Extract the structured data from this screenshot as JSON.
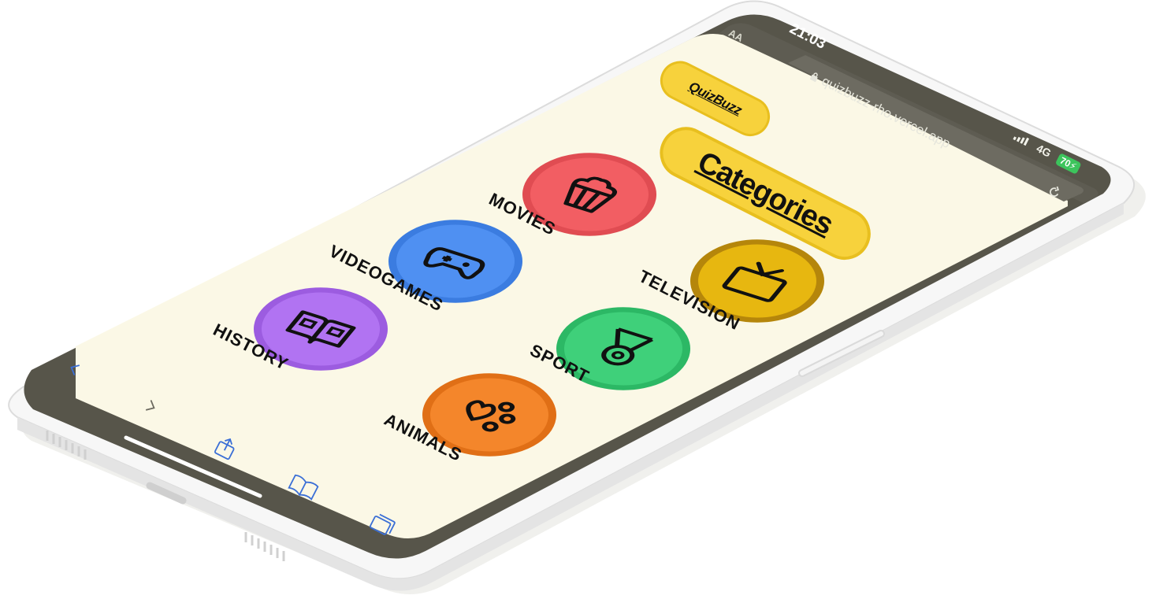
{
  "status_bar": {
    "time": "21:03",
    "text_size_label": "AA",
    "url": "quizbuzz-rho.vercel.app",
    "network": "4G",
    "battery": "70"
  },
  "app": {
    "logo": "QuizBuzz",
    "title": "Categories",
    "categories": [
      {
        "label": "MOVIES",
        "color": "#f25e63",
        "icon": "popcorn-icon"
      },
      {
        "label": "VIDEOGAMES",
        "color": "#4f90f2",
        "icon": "gamepad-icon"
      },
      {
        "label": "HISTORY",
        "color": "#b173f2",
        "icon": "book-icon"
      },
      {
        "label": "TELEVISION",
        "color": "#e7b710",
        "icon": "tv-icon"
      },
      {
        "label": "SPORT",
        "color": "#3fd07a",
        "icon": "medal-icon"
      },
      {
        "label": "ANIMALS",
        "color": "#f4862b",
        "icon": "paw-icon"
      }
    ]
  },
  "colors": {
    "screen_bg": "#fbf8e6",
    "bezel": "#57554a",
    "accent_yellow": "#f7d23c",
    "toolbar_icon": "#3b6fd6"
  }
}
